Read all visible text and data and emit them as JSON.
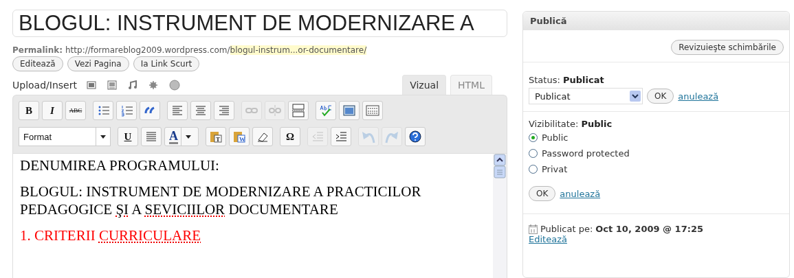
{
  "title_field": {
    "value": "BLOGUL: INSTRUMENT DE MODERNIZARE A"
  },
  "permalink": {
    "label": "Permalink:",
    "base": "http://formareblog2009.wordpress.com/",
    "slug": "blogul-instrum...or-documentare/"
  },
  "permalink_buttons": [
    "Editează",
    "Vezi Pagina",
    "Ia Link Scurt"
  ],
  "upload": {
    "label": "Upload/Insert",
    "icons": [
      {
        "kind": "image"
      },
      {
        "kind": "video"
      },
      {
        "kind": "audio"
      },
      {
        "kind": "media"
      },
      {
        "kind": "circle"
      }
    ]
  },
  "editor_tabs": [
    {
      "label": "Vizual",
      "selected": true
    },
    {
      "label": "HTML",
      "selected": false
    }
  ],
  "toolbar_rows": [
    [
      [
        {
          "kind": "bold",
          "label": "B",
          "disabled": false
        },
        {
          "kind": "italic",
          "label": "I",
          "disabled": false
        },
        {
          "kind": "strike",
          "label": "ABC",
          "disabled": false
        }
      ],
      [
        {
          "kind": "bullets",
          "disabled": false
        },
        {
          "kind": "numbers",
          "disabled": false
        },
        {
          "kind": "quote",
          "disabled": false
        }
      ],
      [
        {
          "kind": "align-left",
          "disabled": false
        },
        {
          "kind": "align-center",
          "disabled": false
        },
        {
          "kind": "align-right",
          "disabled": false
        }
      ],
      [
        {
          "kind": "link",
          "disabled": true
        },
        {
          "kind": "unlink",
          "disabled": true
        },
        {
          "kind": "more",
          "disabled": false
        }
      ],
      [
        {
          "kind": "spell",
          "disabled": false
        },
        {
          "kind": "fullscreen",
          "disabled": false
        },
        {
          "kind": "kitchen",
          "disabled": false
        }
      ]
    ],
    [
      [
        {
          "kind": "select",
          "label": "Format"
        }
      ],
      [
        {
          "kind": "underline",
          "label": "U",
          "disabled": false
        },
        {
          "kind": "justify",
          "disabled": false
        },
        {
          "kind": "color",
          "label": "A"
        }
      ],
      [
        {
          "kind": "paste-text",
          "label": "T",
          "disabled": false
        },
        {
          "kind": "paste-word",
          "label": "W",
          "disabled": false
        },
        {
          "kind": "eraser",
          "disabled": false
        }
      ],
      [
        {
          "kind": "bold",
          "label": "Ω",
          "disabled": false
        }
      ],
      [
        {
          "kind": "outdent",
          "disabled": true
        },
        {
          "kind": "indent",
          "disabled": false
        }
      ],
      [
        {
          "kind": "undo",
          "disabled": true
        },
        {
          "kind": "redo",
          "disabled": true
        },
        {
          "kind": "help",
          "disabled": false
        }
      ]
    ]
  ],
  "content": [
    {
      "color": "#000000",
      "segments": [
        {
          "text": "DENUMIREA PROGRAMULUI:",
          "misspelled": false
        }
      ]
    },
    {
      "color": "#000000",
      "segments": [
        {
          "text": "BLOGUL: INSTRUMENT DE MODERNIZARE A PRACTICILOR PEDAGOGICE ",
          "misspelled": false
        },
        {
          "text": "ŞI",
          "misspelled": true
        },
        {
          "text": " A ",
          "misspelled": false
        },
        {
          "text": "SEVICIILOR",
          "misspelled": true
        },
        {
          "text": " DOCUMENTARE",
          "misspelled": false
        }
      ]
    },
    {
      "color": "#ff0000",
      "segments": [
        {
          "text": "1. CRITERII ",
          "misspelled": false
        },
        {
          "text": "CURRICULARE",
          "misspelled": true
        }
      ]
    }
  ],
  "publish": {
    "title": "Publică",
    "review_button": "Revizuieşte schimbările",
    "status": {
      "label": "Status:",
      "value": "Publicat",
      "select": "Publicat",
      "ok": "OK",
      "cancel": "anulează"
    },
    "visibility": {
      "label": "Vizibilitate:",
      "value": "Public",
      "options": [
        {
          "label": "Public",
          "selected": true
        },
        {
          "label": "Password protected",
          "selected": false
        },
        {
          "label": "Privat",
          "selected": false
        }
      ],
      "ok": "OK",
      "cancel": "anulează"
    },
    "published": {
      "label": "Publicat pe:",
      "date": "Oct 10, 2009 @ 17:25",
      "edit": "Editează"
    }
  }
}
